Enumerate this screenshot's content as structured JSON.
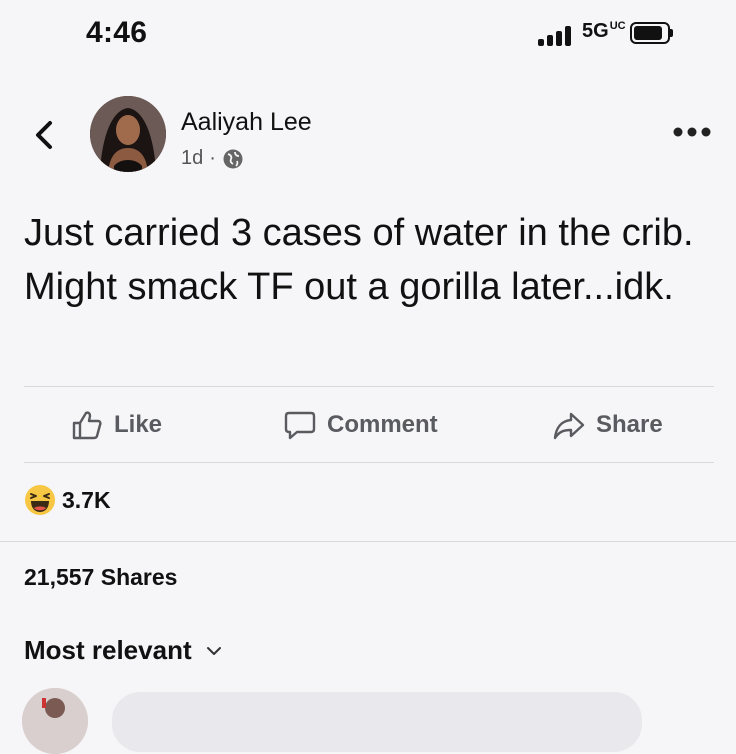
{
  "status_bar": {
    "time": "4:46",
    "network": "5G",
    "network_sub": "UC"
  },
  "post": {
    "author": "Aaliyah Lee",
    "age": "1d",
    "separator": "·",
    "text": "Just carried 3 cases of water in the crib. Might smack TF out a gorilla later...idk."
  },
  "actions": {
    "like": "Like",
    "comment": "Comment",
    "share": "Share"
  },
  "reactions": {
    "count": "3.7K",
    "type_icon": "laughing-emoji-icon"
  },
  "shares": "21,557 Shares",
  "comments": {
    "sort_label": "Most relevant"
  },
  "colors": {
    "background": "#f6f5f7",
    "action_text": "#5a5b60",
    "reaction_yellow": "#f7c744"
  }
}
